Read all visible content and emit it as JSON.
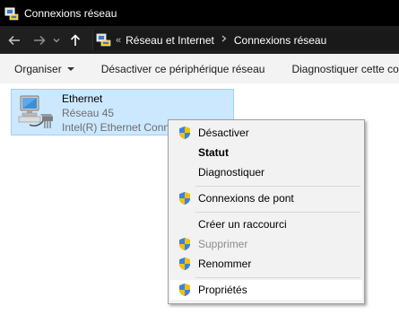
{
  "window": {
    "title": "Connexions réseau"
  },
  "nav": {
    "back_icon": "arrow-left-icon",
    "forward_icon": "arrow-right-icon",
    "recent_icon": "chevron-down-icon",
    "up_icon": "arrow-up-icon",
    "address_sep": "«",
    "breadcrumbs": [
      "Réseau et Internet",
      "Connexions réseau"
    ]
  },
  "toolbar": {
    "organize": "Organiser",
    "disable": "Désactiver ce périphérique réseau",
    "diagnose": "Diagnostiquer cette conn"
  },
  "connection": {
    "name": "Ethernet",
    "network": "Réseau 45",
    "adapter": "Intel(R) Ethernet Conn"
  },
  "context_menu": {
    "items": [
      {
        "label": "Désactiver",
        "shield": true,
        "bold": false,
        "disabled": false
      },
      {
        "label": "Statut",
        "shield": false,
        "bold": true,
        "disabled": false
      },
      {
        "label": "Diagnostiquer",
        "shield": false,
        "bold": false,
        "disabled": false
      },
      {
        "label": "Connexions de pont",
        "shield": true,
        "bold": false,
        "disabled": false
      },
      {
        "label": "Créer un raccourci",
        "shield": false,
        "bold": false,
        "disabled": false
      },
      {
        "label": "Supprimer",
        "shield": true,
        "bold": false,
        "disabled": true
      },
      {
        "label": "Renommer",
        "shield": true,
        "bold": false,
        "disabled": false
      },
      {
        "label": "Propriétés",
        "shield": true,
        "bold": false,
        "disabled": false,
        "highlighted": true
      }
    ]
  },
  "colors": {
    "titlebar": "#000000",
    "navbar": "#1f1f1f",
    "selection_fill": "#cce8ff",
    "selection_border": "#99d1ff",
    "menu_bg": "#f2f2f2",
    "shield_blue": "#2f6fd6",
    "shield_yellow": "#f2c200"
  }
}
